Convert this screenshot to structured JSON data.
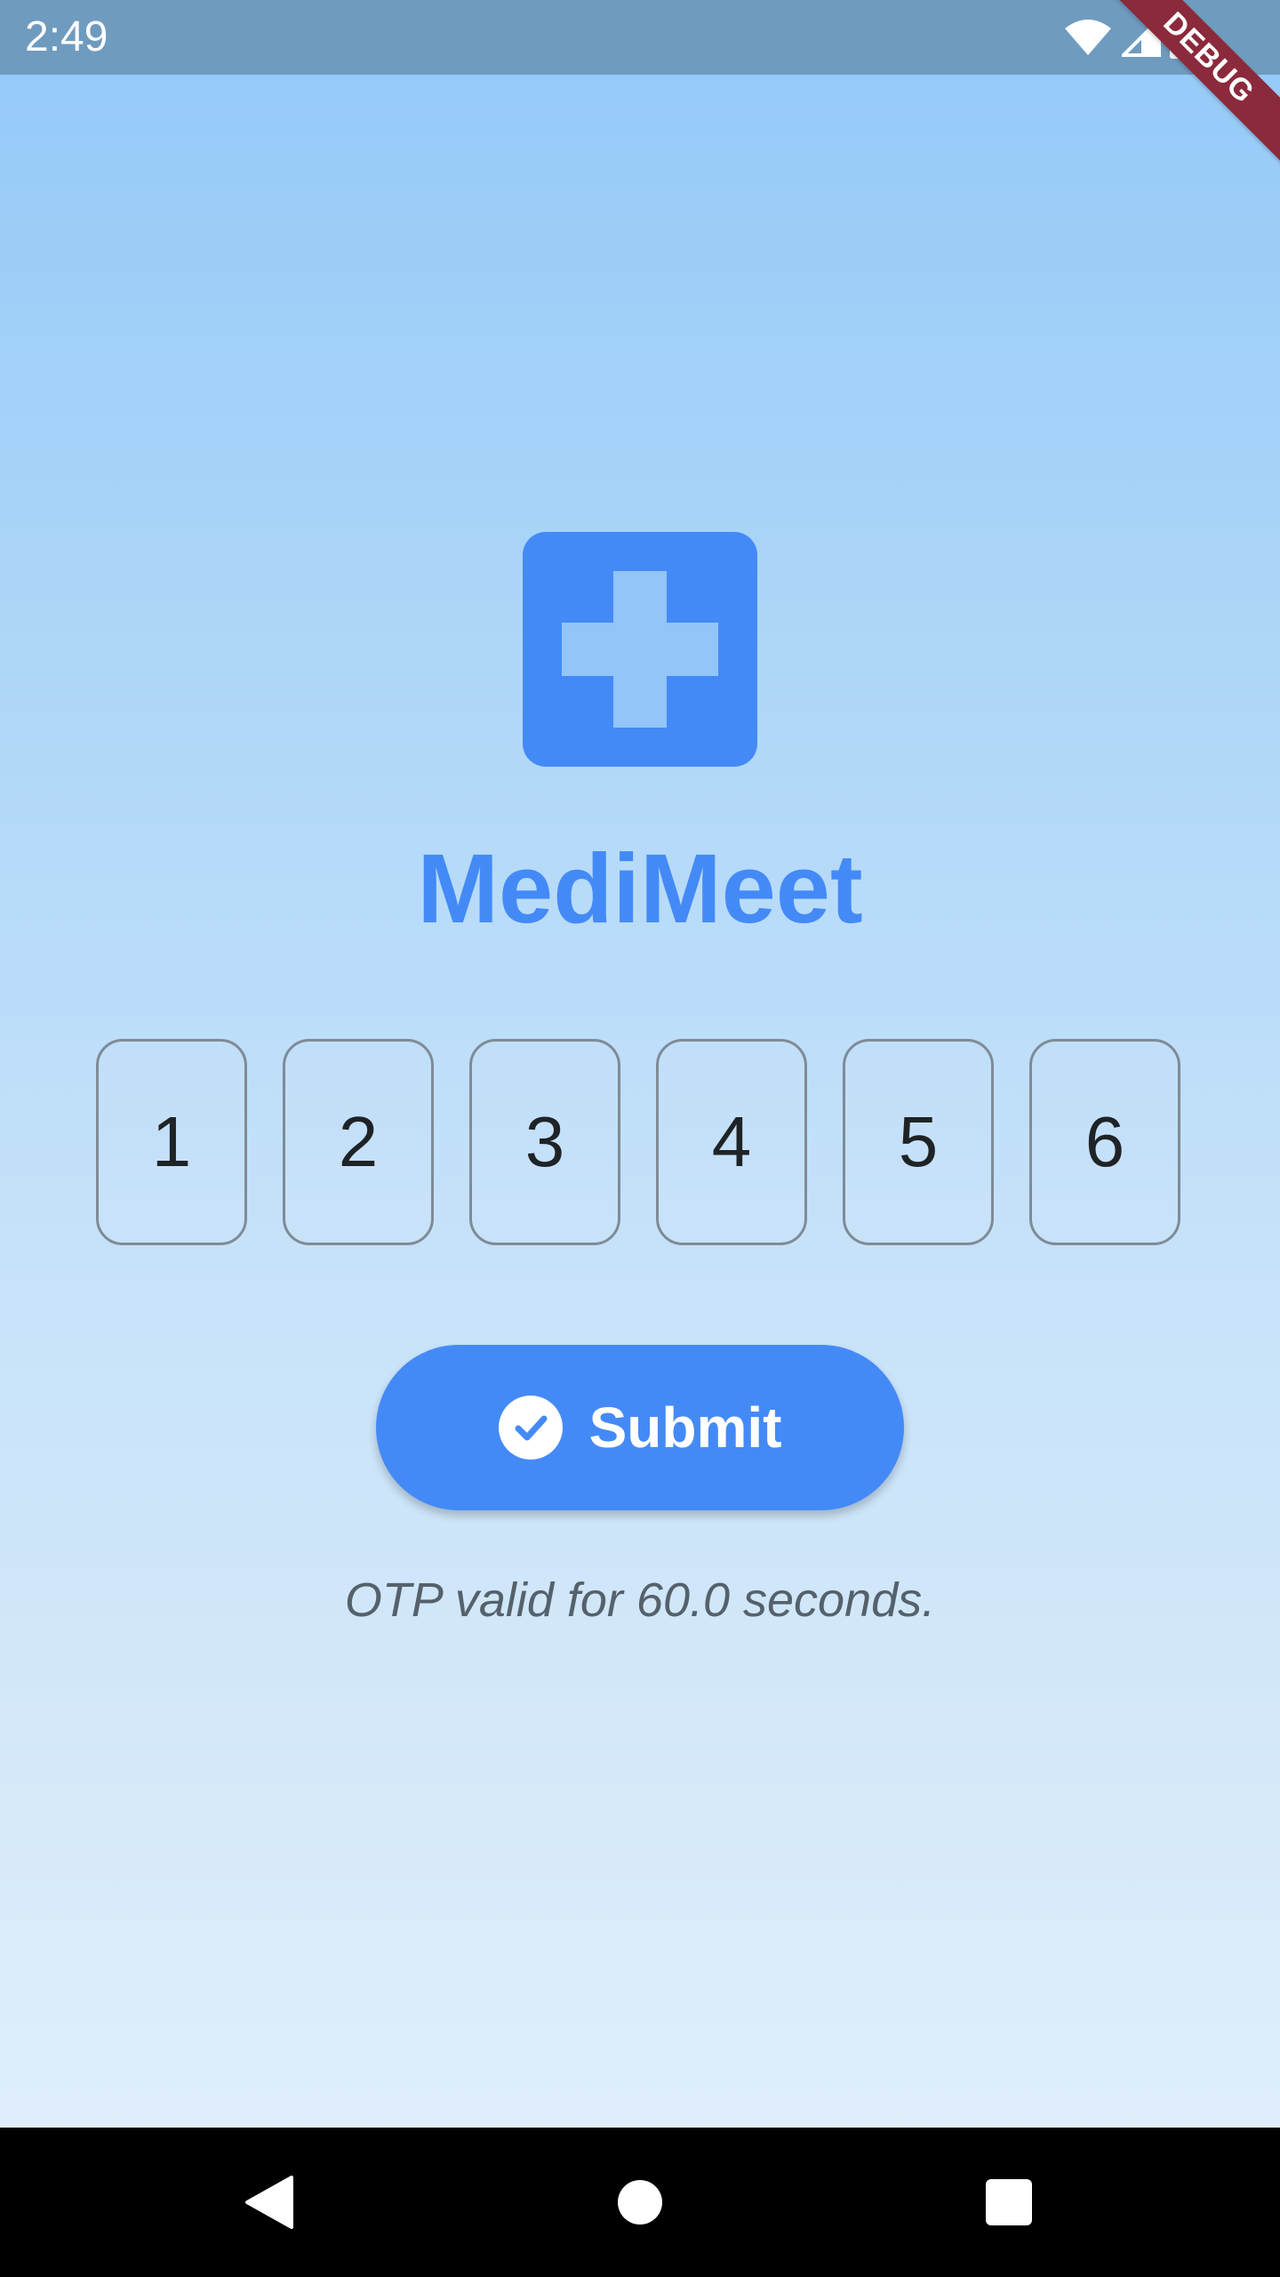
{
  "status_bar": {
    "time": "2:49",
    "icons": [
      "wifi-icon",
      "signal-icon",
      "battery-icon"
    ]
  },
  "debug_banner": {
    "label": "DEBUG"
  },
  "app": {
    "title": "MediMeet",
    "logo_icon": "medical-cross-icon",
    "brand_color": "#448af7"
  },
  "otp": {
    "digits": [
      "1",
      "2",
      "3",
      "4",
      "5",
      "6"
    ]
  },
  "submit_button": {
    "label": "Submit",
    "icon": "check-circle-icon"
  },
  "otp_note": "OTP valid for 60.0 seconds.",
  "nav_bar": {
    "buttons": [
      "back-icon",
      "home-icon",
      "recents-icon"
    ]
  }
}
